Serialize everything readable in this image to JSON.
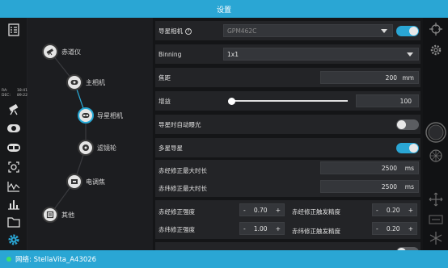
{
  "title": "设置",
  "left_rail": {
    "coords": {
      "ra_label": "RA:",
      "ra_value": "18:41",
      "dec_label": "DEC:",
      "dec_value": "89:22"
    },
    "icons": [
      "checklist-icon",
      "telescope-icon",
      "camera-icon",
      "guide-camera-icon",
      "filter-wheel-icon",
      "focus-icon",
      "guide-graph-icon",
      "histogram-icon",
      "folder-icon",
      "settings-gear-icon"
    ]
  },
  "device_tree": {
    "nodes": [
      {
        "label": "赤道仪",
        "icon": "mount-icon"
      },
      {
        "label": "主相机",
        "icon": "main-camera-icon"
      },
      {
        "label": "导星相机",
        "icon": "guide-camera-icon"
      },
      {
        "label": "滤镜轮",
        "icon": "filter-wheel-icon"
      },
      {
        "label": "电调焦",
        "icon": "focuser-icon"
      },
      {
        "label": "其他",
        "icon": "other-icon"
      }
    ]
  },
  "settings": {
    "guide_camera": {
      "label": "导星相机",
      "value": "GPM462C",
      "enabled": true
    },
    "binning": {
      "label": "Binning",
      "value": "1x1"
    },
    "focal_length": {
      "label": "焦距",
      "value": "200",
      "unit": "mm"
    },
    "gain": {
      "label": "增益",
      "value": "100",
      "slider_fraction": 0.0
    },
    "auto_exposure": {
      "label": "导星时自动曝光",
      "enabled": false
    },
    "multi_star": {
      "label": "多星导星",
      "enabled": true
    },
    "ra_max_duration": {
      "label": "赤经修正最大时长",
      "value": "2500",
      "unit": "ms"
    },
    "dec_max_duration": {
      "label": "赤纬修正最大时长",
      "value": "2500",
      "unit": "ms"
    },
    "ra_strength": {
      "label": "赤经修正强度",
      "value": "0.70",
      "minus": "-",
      "plus": "+"
    },
    "ra_trigger": {
      "label": "赤经修正触发精度",
      "value": "0.20",
      "minus": "-",
      "plus": "+"
    },
    "dec_strength": {
      "label": "赤纬修正强度",
      "value": "1.00",
      "minus": "-",
      "plus": "+"
    },
    "dec_trigger": {
      "label": "赤纬修正触发精度",
      "value": "0.20",
      "minus": "-",
      "plus": "+"
    }
  },
  "right_rail": {
    "icons": [
      "crosshair-settings-icon",
      "gear-icon",
      "shutter-button-icon",
      "wheel-icon",
      "move-arrows-icon",
      "bin-icon",
      "snowflake-icon"
    ]
  },
  "status": {
    "network_label": "网络: StellaVita_A43026"
  },
  "colors": {
    "accent": "#2aa6d4",
    "status_dot": "#3ee06a"
  }
}
